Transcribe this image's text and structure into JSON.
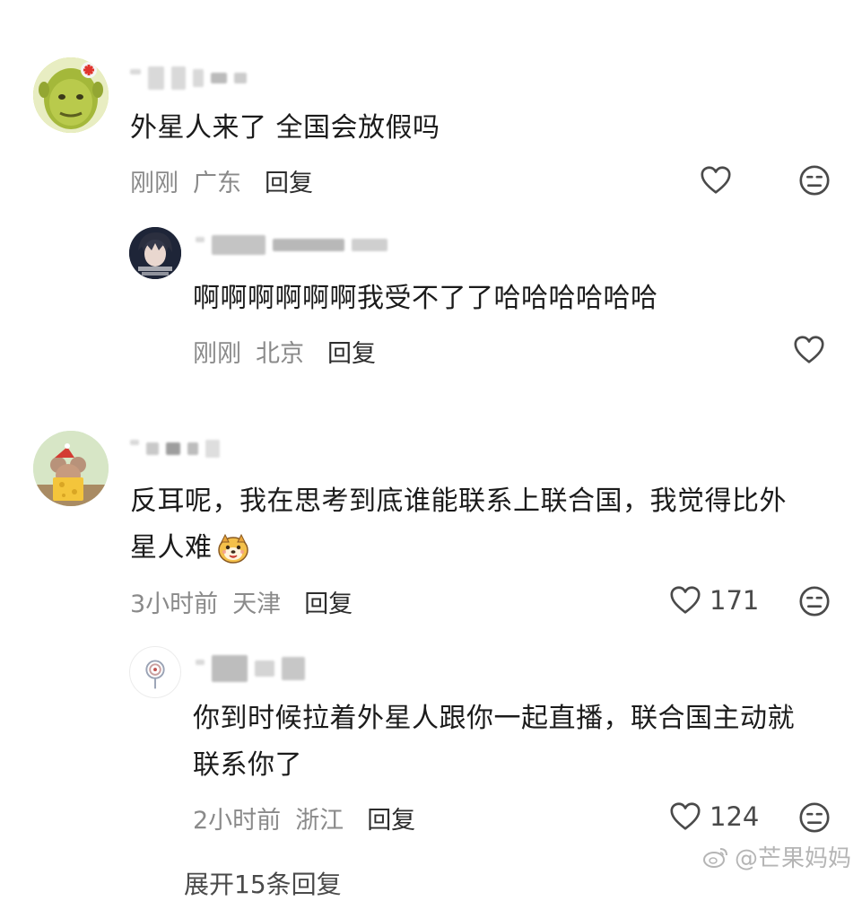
{
  "comments": [
    {
      "text": "外星人来了  全国会放假吗",
      "time": "刚刚",
      "location": "广东",
      "reply_label": "回复",
      "replies": [
        {
          "text": "啊啊啊啊啊啊我受不了了哈哈哈哈哈哈",
          "time": "刚刚",
          "location": "北京",
          "reply_label": "回复"
        }
      ]
    },
    {
      "text_line1": "反耳呢，我在思考到底谁能联系上联合国，我觉得比外",
      "text_line2": "星人难",
      "emoji_icon": "cute-dog-face-emoji",
      "time": "3小时前",
      "location": "天津",
      "reply_label": "回复",
      "like_count": "171",
      "replies": [
        {
          "text_line1": "你到时候拉着外星人跟你一起直播，联合国主动就",
          "text_line2": "联系你了",
          "time": "2小时前",
          "location": "浙江",
          "reply_label": "回复",
          "like_count": "124"
        }
      ]
    }
  ],
  "more_replies": "展开15条回复",
  "watermark": "@芒果妈妈",
  "colors": {
    "meta_gray": "#8a8a8a",
    "text": "#1b1b1b"
  }
}
